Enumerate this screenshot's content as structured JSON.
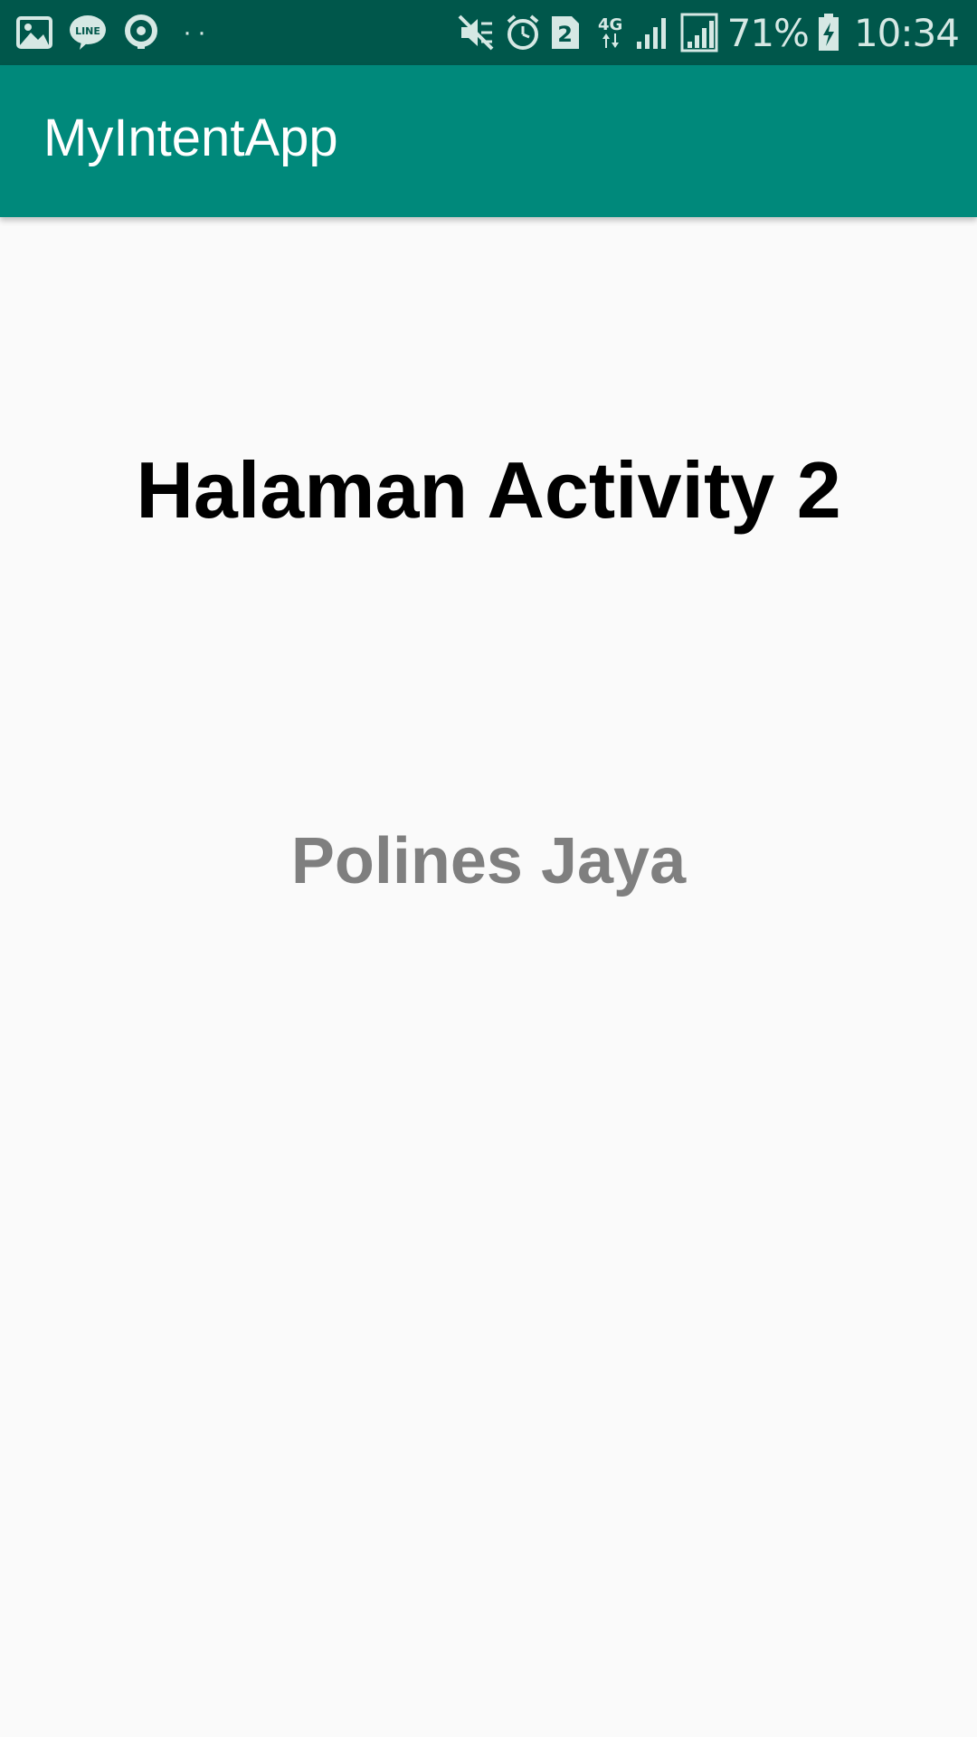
{
  "status_bar": {
    "left_icons": [
      "gallery-icon",
      "line-app-icon",
      "location-icon"
    ],
    "more_indicator": "··",
    "right_icons": [
      "mute-vibrate-icon",
      "alarm-icon",
      "sim-2-icon",
      "network-4g-icon",
      "signal-icon",
      "signal-icon",
      "battery-charging-icon"
    ],
    "sim_number": "2",
    "network_type": "4G",
    "battery": "71%",
    "time": "10:34"
  },
  "app_bar": {
    "title": "MyIntentApp"
  },
  "content": {
    "heading": "Halaman Activity 2",
    "subtext": "Polines Jaya"
  },
  "colors": {
    "status_bar": "#00574b",
    "app_bar": "#00897b",
    "background": "#fafafa",
    "heading": "#000000",
    "subtext": "#7f7f7f"
  }
}
